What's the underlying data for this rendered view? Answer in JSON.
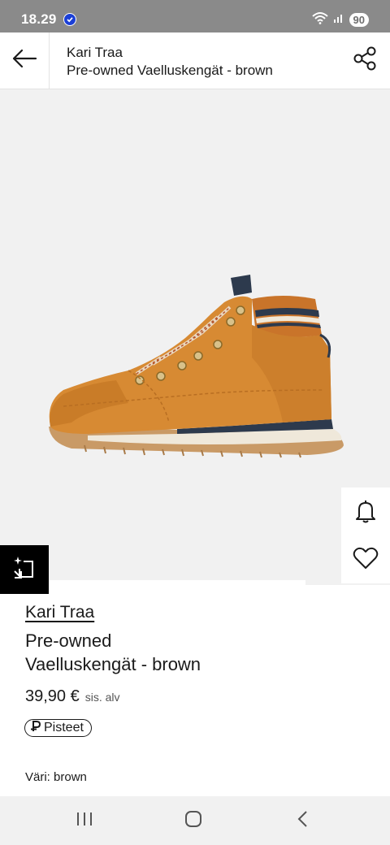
{
  "status_bar": {
    "time": "18.29",
    "battery": "90"
  },
  "header": {
    "brand": "Kari Traa",
    "product_name": "Pre-owned Vaelluskengät - brown"
  },
  "product": {
    "brand": "Kari Traa",
    "name_line1": "Pre-owned",
    "name_line2": "Vaelluskengät - brown",
    "price": "39,90 €",
    "price_note": "sis. alv",
    "points_label": "Pisteet",
    "color_label": "Väri: brown"
  },
  "icons": {
    "back": "arrow-left-icon",
    "share": "share-icon",
    "notify": "bell-icon",
    "wishlist": "heart-icon",
    "similar": "similar-items-icon",
    "nav_recents": "recents-icon",
    "nav_home": "home-icon",
    "nav_back": "nav-back-icon"
  },
  "colors": {
    "shoe": "#d78a33",
    "status_bar": "#8a8a8a",
    "gallery_bg": "#f1f1f1"
  }
}
